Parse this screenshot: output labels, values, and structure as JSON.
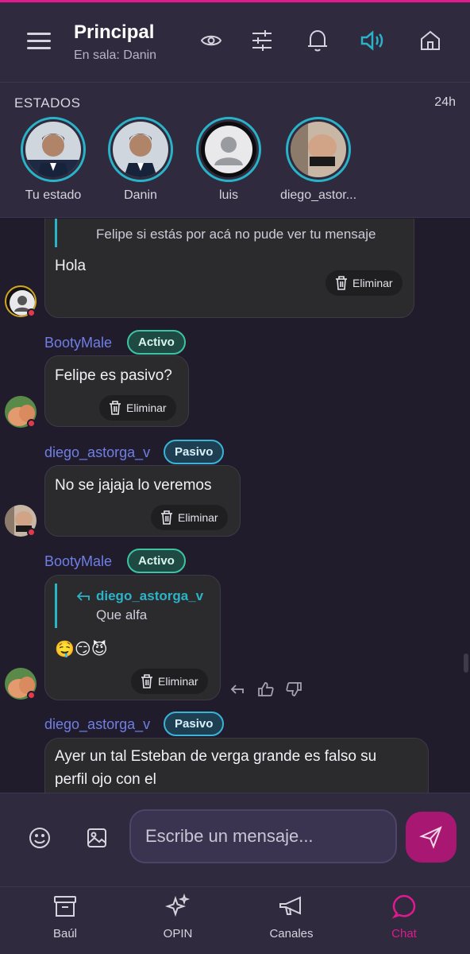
{
  "header": {
    "title": "Principal",
    "subtitle": "En sala: Danin"
  },
  "estados": {
    "title": "ESTADOS",
    "time": "24h",
    "stories": [
      {
        "name": "Tu estado"
      },
      {
        "name": "Danin"
      },
      {
        "name": "luis"
      },
      {
        "name": "diego_astor..."
      }
    ]
  },
  "messages": [
    {
      "reply_text": "Felipe  si estás por acá no pude ver tu mensaje",
      "text": "Hola",
      "delete_label": "Eliminar"
    },
    {
      "user": "BootyMale",
      "badge": "Activo",
      "text": "Felipe es pasivo?",
      "delete_label": "Eliminar"
    },
    {
      "user": "diego_astorga_v",
      "badge": "Pasivo",
      "text": "No se jajaja  lo veremos",
      "delete_label": "Eliminar"
    },
    {
      "user": "BootyMale",
      "badge": "Activo",
      "reply_user": "diego_astorga_v",
      "reply_text": "Que alfa",
      "text": "🤤😏😈",
      "delete_label": "Eliminar"
    },
    {
      "user": "diego_astorga_v",
      "badge": "Pasivo",
      "text_line1": "Ayer un tal Esteban  de verga grande es falso su",
      "text_line2": "perfil ojo con  el"
    }
  ],
  "composer": {
    "placeholder": "Escribe un mensaje..."
  },
  "nav": {
    "items": [
      {
        "label": "Baúl",
        "icon": "archive-icon"
      },
      {
        "label": "OPIN",
        "icon": "sparkles-icon"
      },
      {
        "label": "Canales",
        "icon": "megaphone-icon"
      },
      {
        "label": "Chat",
        "icon": "chat-icon"
      }
    ]
  },
  "colors": {
    "accent": "#e0198f",
    "teal": "#29b3c9",
    "username": "#6f7fe6",
    "background": "#201c2b"
  }
}
